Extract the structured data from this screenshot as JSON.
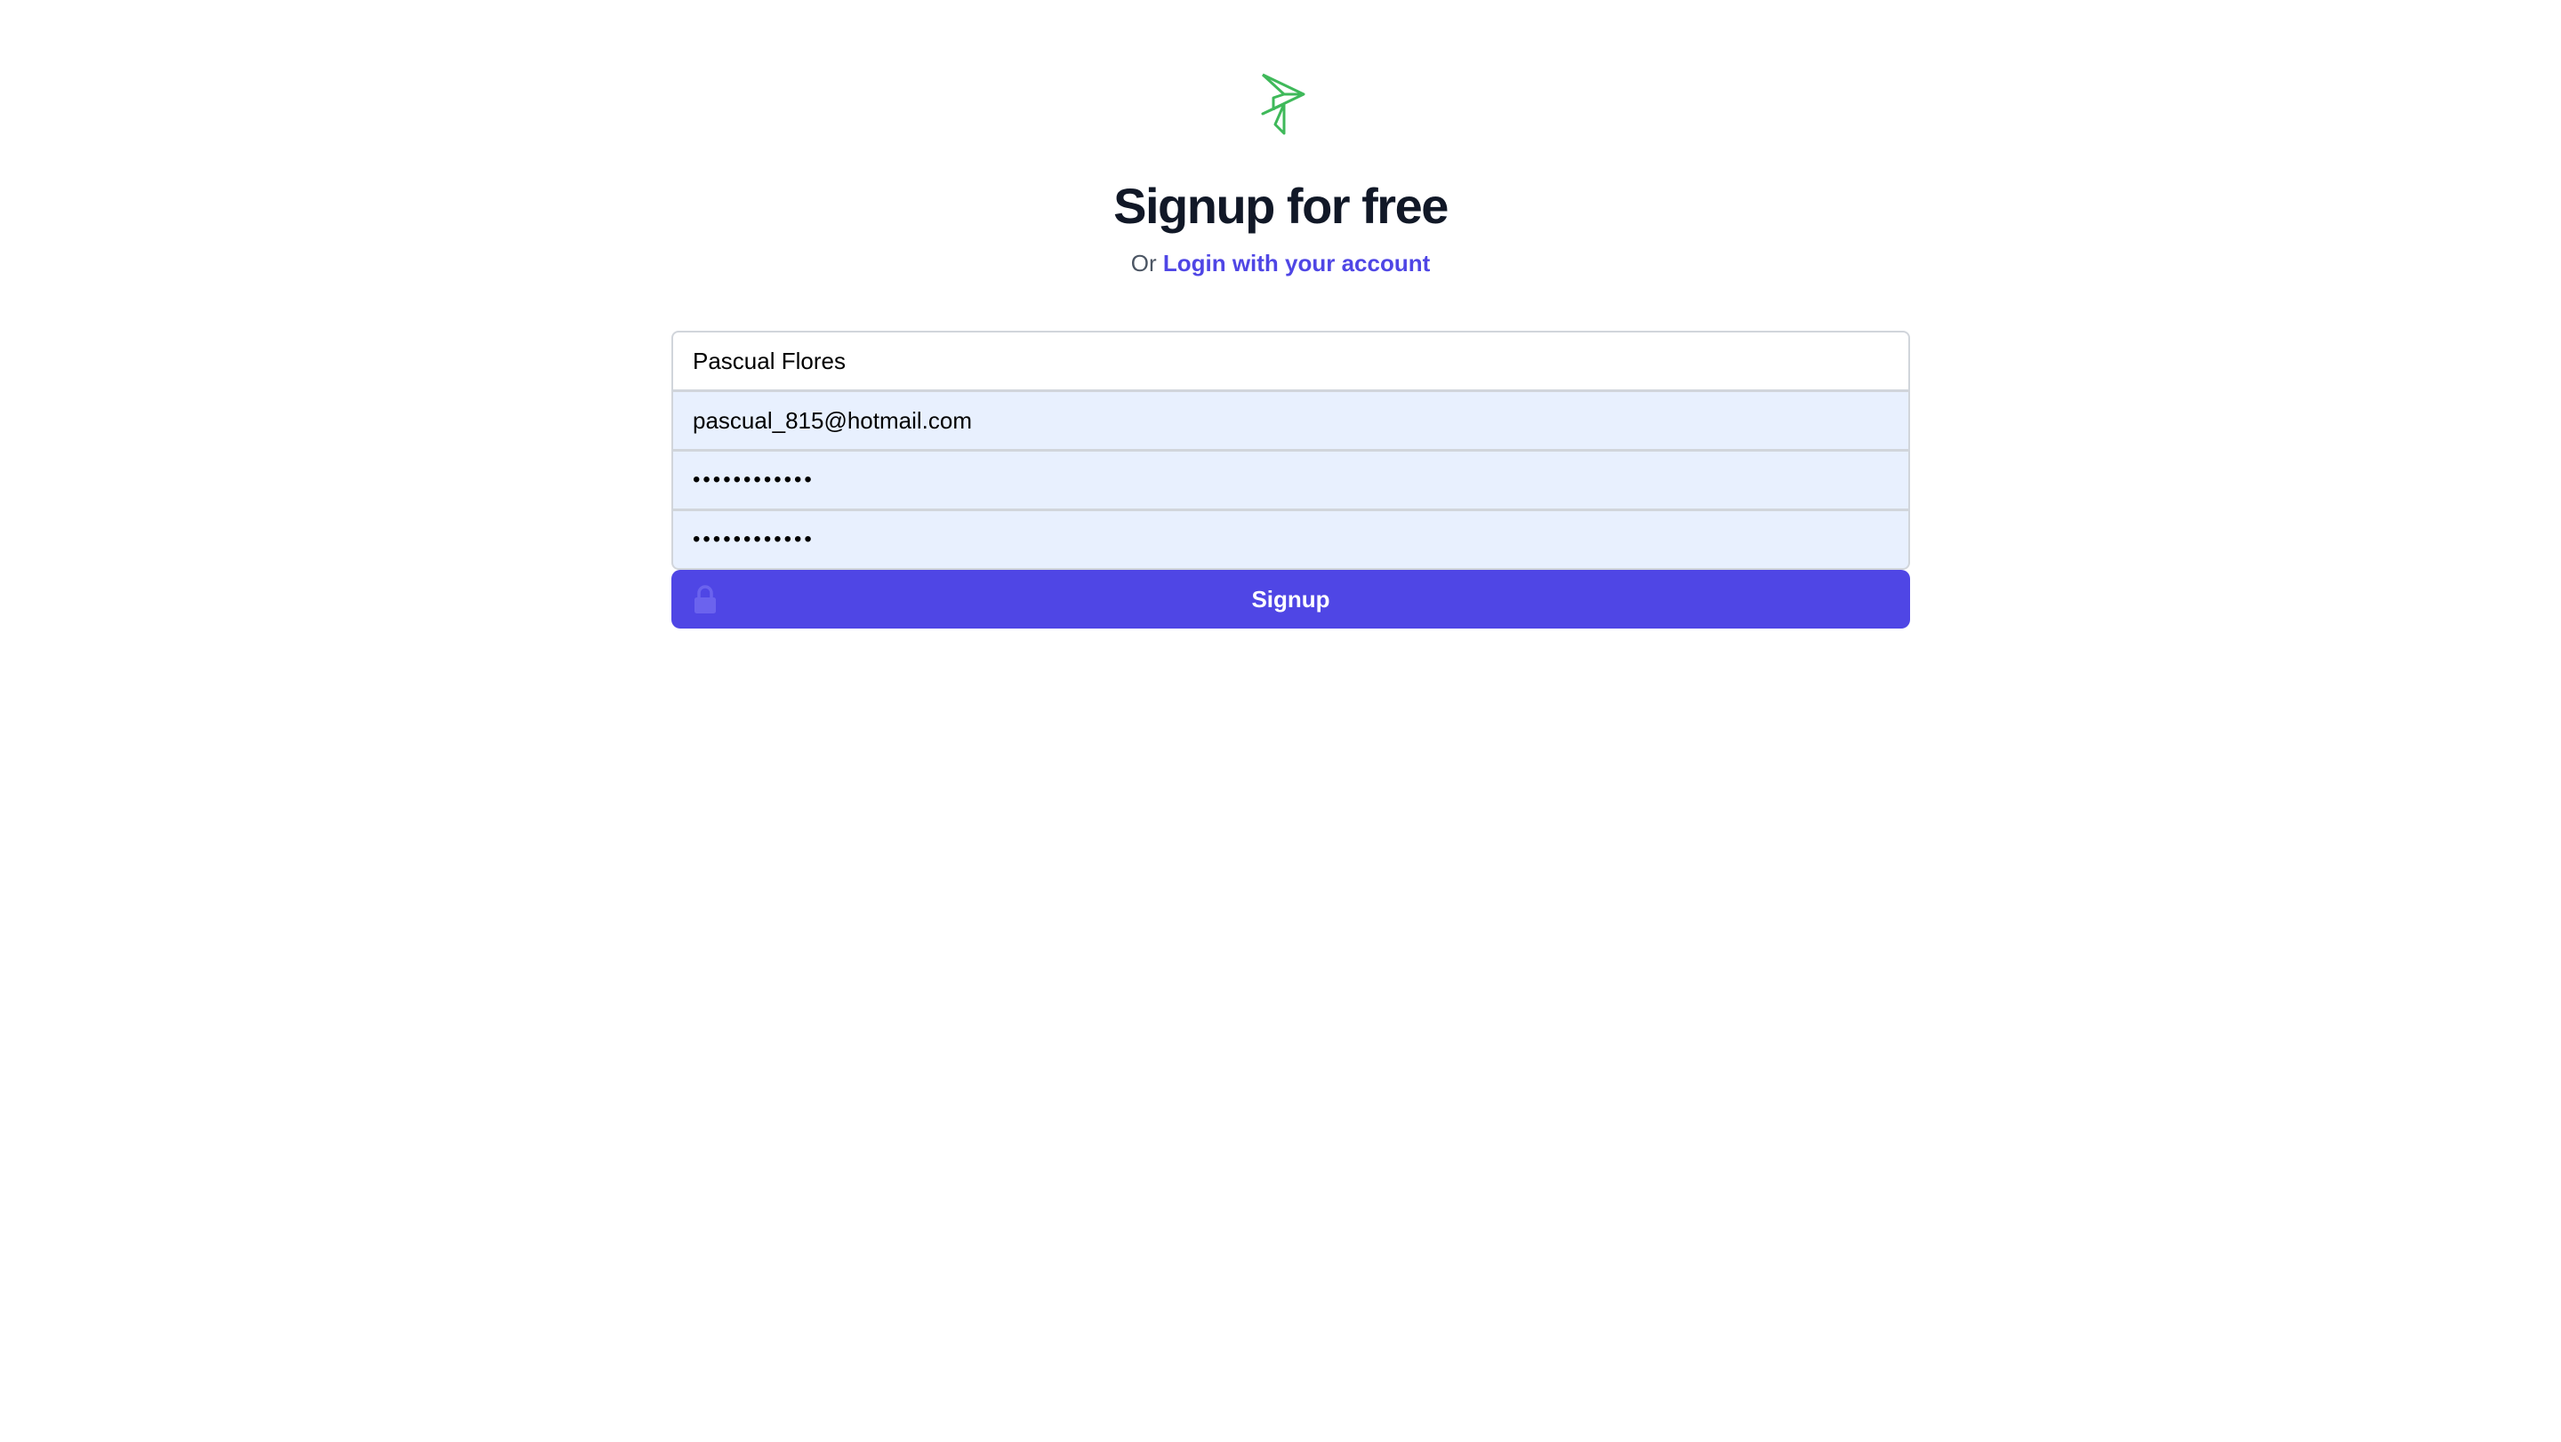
{
  "header": {
    "logo_icon": "paper-plane-logo-icon",
    "title": "Signup for free",
    "subtitle_prefix": "Or",
    "login_link": "Login with your account"
  },
  "form": {
    "name_value": "Pascual Flores",
    "email_value": "pascual_815@hotmail.com",
    "password_value": "••••••••••••",
    "confirm_password_value": "••••••••••••",
    "submit_label": "Signup",
    "submit_icon": "lock-icon"
  },
  "colors": {
    "accent": "#4f46e5",
    "logo": "#3fb95a",
    "autofill_bg": "#e8f0fe",
    "title": "#111827"
  }
}
